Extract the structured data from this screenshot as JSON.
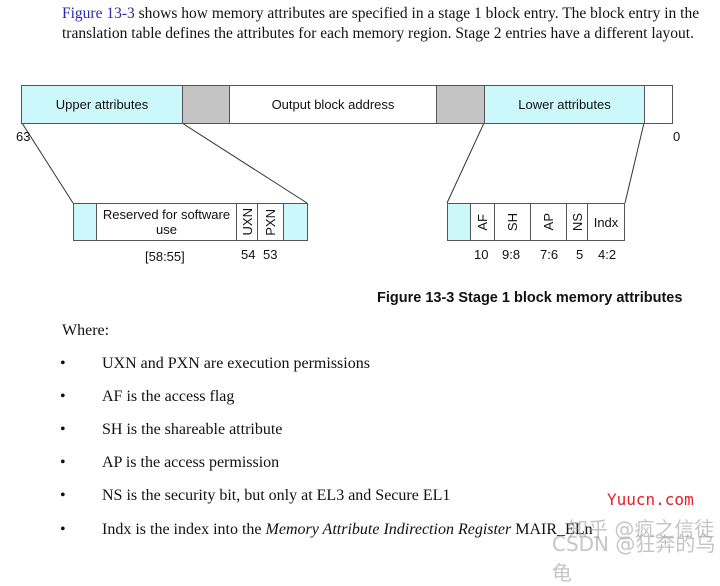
{
  "intro": {
    "link_text": "Figure 13-3",
    "text": " shows how memory attributes are specified in a stage 1 block entry. The block entry in the translation table defines the attributes for each memory region. Stage 2 entries have a different layout."
  },
  "diagram": {
    "top_row": {
      "upper_attributes": "Upper attributes",
      "output_block_address": "Output block address",
      "lower_attributes": "Lower attributes",
      "bit_high": "63",
      "bit_low": "0"
    },
    "upper_detail": {
      "reserved": "Reserved for software use",
      "uxn": "UXN",
      "pxn": "PXN",
      "reserved_bits": "[58:55]",
      "uxn_bit": "54",
      "pxn_bit": "53"
    },
    "lower_detail": {
      "af": "AF",
      "sh": "SH",
      "ap": "AP",
      "ns": "NS",
      "indx": "Indx",
      "af_bit": "10",
      "sh_bits": "9:8",
      "ap_bits": "7:6",
      "ns_bit": "5",
      "indx_bits": "4:2"
    },
    "colors": {
      "attribute_fill": "#ccf7fb",
      "reserved_fill": "#c4c4c4"
    }
  },
  "caption": "Figure 13-3 Stage 1 block memory attributes",
  "where_label": "Where:",
  "bullets": [
    {
      "text": "UXN and PXN are execution permissions"
    },
    {
      "text": "AF is the access flag"
    },
    {
      "text": "SH is the shareable attribute"
    },
    {
      "text": "AP is the access permission"
    },
    {
      "text": "NS is the security bit, but only at EL3 and Secure EL1"
    },
    {
      "text": "Indx is the index into the ",
      "italic": "Memory Attribute Indirection Register",
      "suffix": " MAIR_ELn"
    }
  ],
  "bullet_symbol": "•",
  "watermarks": {
    "site": "Yuucn.com",
    "zhihu": "知乎 @疯之信徒",
    "csdn": "CSDN @狂奔的乌龟"
  }
}
